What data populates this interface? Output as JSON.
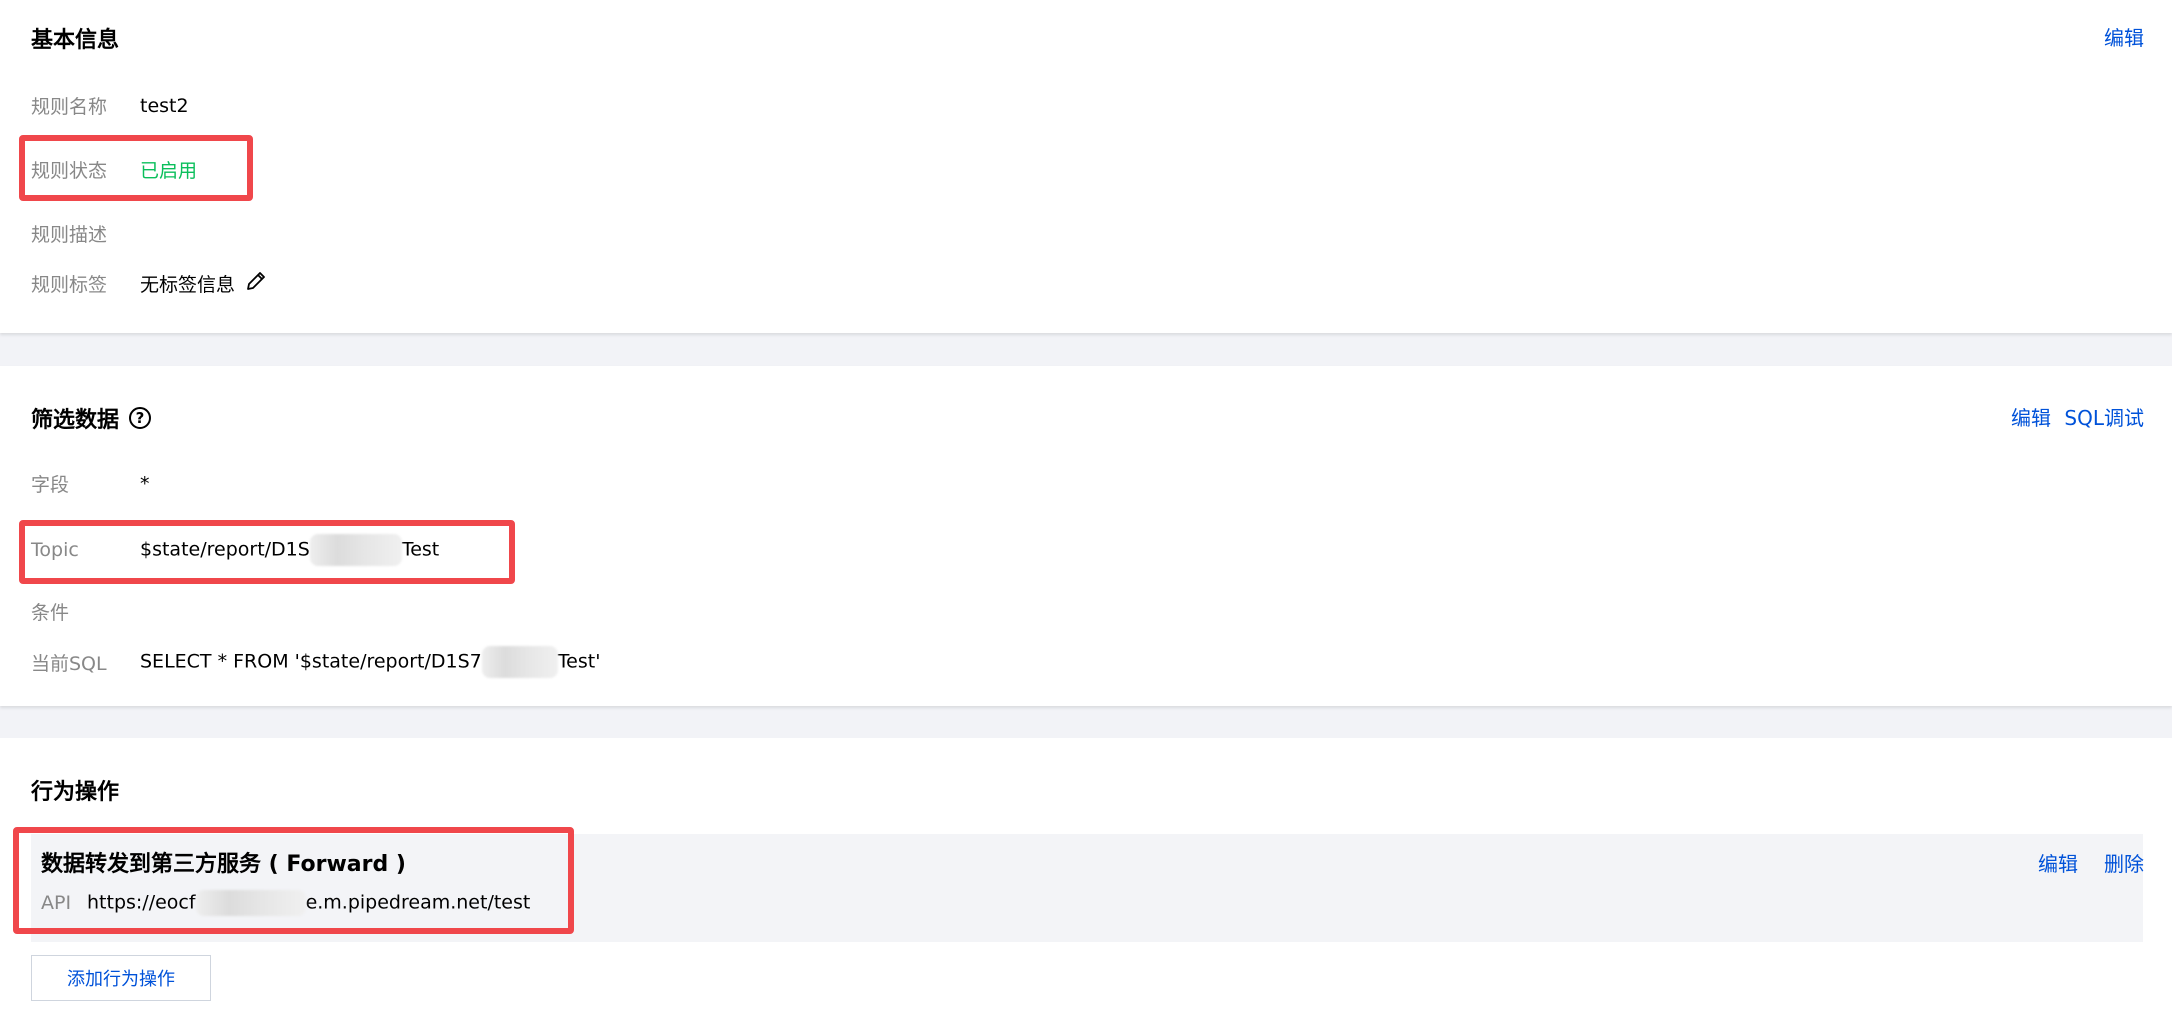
{
  "basic_info": {
    "title": "基本信息",
    "edit_label": "编辑",
    "fields": {
      "name_label": "规则名称",
      "name_value": "test2",
      "status_label": "规则状态",
      "status_value": "已启用",
      "desc_label": "规则描述",
      "desc_value": "",
      "tags_label": "规则标签",
      "tags_value": "无标签信息"
    }
  },
  "filter_data": {
    "title": "筛选数据",
    "edit_label": "编辑",
    "sql_debug_label": "SQL调试",
    "fields": {
      "field_label": "字段",
      "field_value": "*",
      "topic_label": "Topic",
      "topic_prefix": "$state/report/D1S",
      "topic_suffix": "Test",
      "cond_label": "条件",
      "cond_value": "",
      "sql_label": "当前SQL",
      "sql_prefix": "SELECT * FROM '$state/report/D1S7",
      "sql_suffix": "Test'"
    }
  },
  "actions": {
    "title": "行为操作",
    "item": {
      "title": "数据转发到第三方服务 ( Forward )",
      "api_label": "API",
      "api_prefix": "https://eocf",
      "api_suffix": "e.m.pipedream.net/test",
      "edit_label": "编辑",
      "delete_label": "删除"
    },
    "add_button_label": "添加行为操作"
  },
  "colors": {
    "link": "#0052d9",
    "status_enabled": "#0abf5b",
    "highlight_box": "#f0474b"
  }
}
